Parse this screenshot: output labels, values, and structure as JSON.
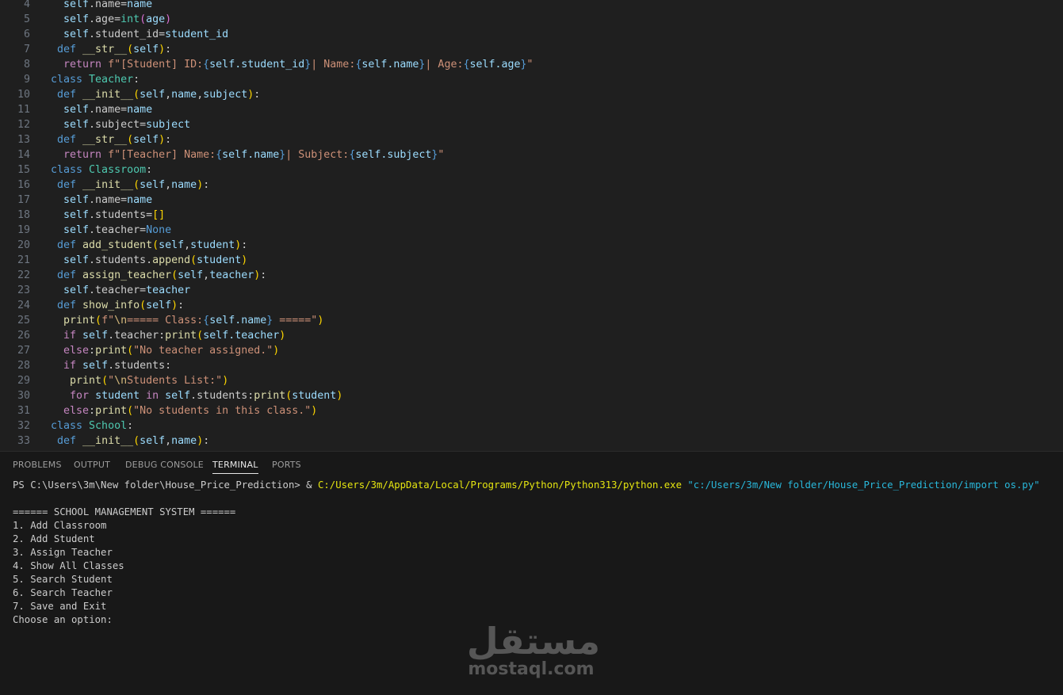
{
  "editor": {
    "lines": [
      {
        "n": "4",
        "code": [
          [
            "  ",
            "p"
          ],
          [
            "self",
            "v"
          ],
          [
            ".name=",
            "p"
          ],
          [
            "name",
            "v"
          ]
        ]
      },
      {
        "n": "5",
        "code": [
          [
            "  ",
            "p"
          ],
          [
            "self",
            "v"
          ],
          [
            ".age=",
            "p"
          ],
          [
            "int",
            "t"
          ],
          [
            "(",
            "b2"
          ],
          [
            "age",
            "v"
          ],
          [
            ")",
            "b2"
          ]
        ]
      },
      {
        "n": "6",
        "code": [
          [
            "  ",
            "p"
          ],
          [
            "self",
            "v"
          ],
          [
            ".student_id=",
            "p"
          ],
          [
            "student_id",
            "v"
          ]
        ]
      },
      {
        "n": "7",
        "code": [
          [
            " ",
            "p"
          ],
          [
            "def ",
            "k"
          ],
          [
            "__str__",
            "f"
          ],
          [
            "(",
            "b"
          ],
          [
            "self",
            "v"
          ],
          [
            ")",
            "b"
          ],
          [
            ":",
            "p"
          ]
        ]
      },
      {
        "n": "8",
        "code": [
          [
            "  ",
            "p"
          ],
          [
            "return ",
            "c"
          ],
          [
            "f\"[Student] ID:",
            "s"
          ],
          [
            "{",
            "k"
          ],
          [
            "self.student_id",
            "v"
          ],
          [
            "}",
            "k"
          ],
          [
            "| Name:",
            "s"
          ],
          [
            "{",
            "k"
          ],
          [
            "self.name",
            "v"
          ],
          [
            "}",
            "k"
          ],
          [
            "| Age:",
            "s"
          ],
          [
            "{",
            "k"
          ],
          [
            "self.age",
            "v"
          ],
          [
            "}",
            "k"
          ],
          [
            "\"",
            "s"
          ]
        ]
      },
      {
        "n": "9",
        "code": [
          [
            "class ",
            "k"
          ],
          [
            "Teacher",
            "t"
          ],
          [
            ":",
            "p"
          ]
        ]
      },
      {
        "n": "10",
        "code": [
          [
            " ",
            "p"
          ],
          [
            "def ",
            "k"
          ],
          [
            "__init__",
            "f"
          ],
          [
            "(",
            "b"
          ],
          [
            "self",
            "v"
          ],
          [
            ",",
            "p"
          ],
          [
            "name",
            "v"
          ],
          [
            ",",
            "p"
          ],
          [
            "subject",
            "v"
          ],
          [
            ")",
            "b"
          ],
          [
            ":",
            "p"
          ]
        ]
      },
      {
        "n": "11",
        "code": [
          [
            "  ",
            "p"
          ],
          [
            "self",
            "v"
          ],
          [
            ".name=",
            "p"
          ],
          [
            "name",
            "v"
          ]
        ]
      },
      {
        "n": "12",
        "code": [
          [
            "  ",
            "p"
          ],
          [
            "self",
            "v"
          ],
          [
            ".subject=",
            "p"
          ],
          [
            "subject",
            "v"
          ]
        ]
      },
      {
        "n": "13",
        "code": [
          [
            " ",
            "p"
          ],
          [
            "def ",
            "k"
          ],
          [
            "__str__",
            "f"
          ],
          [
            "(",
            "b"
          ],
          [
            "self",
            "v"
          ],
          [
            ")",
            "b"
          ],
          [
            ":",
            "p"
          ]
        ]
      },
      {
        "n": "14",
        "code": [
          [
            "  ",
            "p"
          ],
          [
            "return ",
            "c"
          ],
          [
            "f\"[Teacher] Name:",
            "s"
          ],
          [
            "{",
            "k"
          ],
          [
            "self.name",
            "v"
          ],
          [
            "}",
            "k"
          ],
          [
            "| Subject:",
            "s"
          ],
          [
            "{",
            "k"
          ],
          [
            "self.subject",
            "v"
          ],
          [
            "}",
            "k"
          ],
          [
            "\"",
            "s"
          ]
        ]
      },
      {
        "n": "15",
        "code": [
          [
            "class ",
            "k"
          ],
          [
            "Classroom",
            "t"
          ],
          [
            ":",
            "p"
          ]
        ]
      },
      {
        "n": "16",
        "code": [
          [
            " ",
            "p"
          ],
          [
            "def ",
            "k"
          ],
          [
            "__init__",
            "f"
          ],
          [
            "(",
            "b"
          ],
          [
            "self",
            "v"
          ],
          [
            ",",
            "p"
          ],
          [
            "name",
            "v"
          ],
          [
            ")",
            "b"
          ],
          [
            ":",
            "p"
          ]
        ]
      },
      {
        "n": "17",
        "code": [
          [
            "  ",
            "p"
          ],
          [
            "self",
            "v"
          ],
          [
            ".name=",
            "p"
          ],
          [
            "name",
            "v"
          ]
        ]
      },
      {
        "n": "18",
        "code": [
          [
            "  ",
            "p"
          ],
          [
            "self",
            "v"
          ],
          [
            ".students=",
            "p"
          ],
          [
            "[]",
            "b"
          ]
        ]
      },
      {
        "n": "19",
        "code": [
          [
            "  ",
            "p"
          ],
          [
            "self",
            "v"
          ],
          [
            ".teacher=",
            "p"
          ],
          [
            "None",
            "k"
          ]
        ]
      },
      {
        "n": "20",
        "code": [
          [
            " ",
            "p"
          ],
          [
            "def ",
            "k"
          ],
          [
            "add_student",
            "f"
          ],
          [
            "(",
            "b"
          ],
          [
            "self",
            "v"
          ],
          [
            ",",
            "p"
          ],
          [
            "student",
            "v"
          ],
          [
            ")",
            "b"
          ],
          [
            ":",
            "p"
          ]
        ]
      },
      {
        "n": "21",
        "code": [
          [
            "  ",
            "p"
          ],
          [
            "self",
            "v"
          ],
          [
            ".students.",
            "p"
          ],
          [
            "append",
            "f"
          ],
          [
            "(",
            "b"
          ],
          [
            "student",
            "v"
          ],
          [
            ")",
            "b"
          ]
        ]
      },
      {
        "n": "22",
        "code": [
          [
            " ",
            "p"
          ],
          [
            "def ",
            "k"
          ],
          [
            "assign_teacher",
            "f"
          ],
          [
            "(",
            "b"
          ],
          [
            "self",
            "v"
          ],
          [
            ",",
            "p"
          ],
          [
            "teacher",
            "v"
          ],
          [
            ")",
            "b"
          ],
          [
            ":",
            "p"
          ]
        ]
      },
      {
        "n": "23",
        "code": [
          [
            "  ",
            "p"
          ],
          [
            "self",
            "v"
          ],
          [
            ".teacher=",
            "p"
          ],
          [
            "teacher",
            "v"
          ]
        ]
      },
      {
        "n": "24",
        "code": [
          [
            " ",
            "p"
          ],
          [
            "def ",
            "k"
          ],
          [
            "show_info",
            "f"
          ],
          [
            "(",
            "b"
          ],
          [
            "self",
            "v"
          ],
          [
            ")",
            "b"
          ],
          [
            ":",
            "p"
          ]
        ]
      },
      {
        "n": "25",
        "code": [
          [
            "  ",
            "p"
          ],
          [
            "print",
            "f"
          ],
          [
            "(",
            "b"
          ],
          [
            "f\"",
            "s"
          ],
          [
            "\\n",
            "e"
          ],
          [
            "===== Class:",
            "s"
          ],
          [
            "{",
            "k"
          ],
          [
            "self.name",
            "v"
          ],
          [
            "}",
            "k"
          ],
          [
            " =====\"",
            "s"
          ],
          [
            ")",
            "b"
          ]
        ]
      },
      {
        "n": "26",
        "code": [
          [
            "  ",
            "p"
          ],
          [
            "if ",
            "c"
          ],
          [
            "self",
            "v"
          ],
          [
            ".teacher:",
            "p"
          ],
          [
            "print",
            "f"
          ],
          [
            "(",
            "b"
          ],
          [
            "self",
            "v"
          ],
          [
            ".teacher",
            "v"
          ],
          [
            ")",
            "b"
          ]
        ]
      },
      {
        "n": "27",
        "code": [
          [
            "  ",
            "p"
          ],
          [
            "else",
            "c"
          ],
          [
            ":",
            "p"
          ],
          [
            "print",
            "f"
          ],
          [
            "(",
            "b"
          ],
          [
            "\"No teacher assigned.\"",
            "s"
          ],
          [
            ")",
            "b"
          ]
        ]
      },
      {
        "n": "28",
        "code": [
          [
            "  ",
            "p"
          ],
          [
            "if ",
            "c"
          ],
          [
            "self",
            "v"
          ],
          [
            ".students:",
            "p"
          ]
        ]
      },
      {
        "n": "29",
        "code": [
          [
            "   ",
            "p"
          ],
          [
            "print",
            "f"
          ],
          [
            "(",
            "b"
          ],
          [
            "\"",
            "s"
          ],
          [
            "\\n",
            "e"
          ],
          [
            "Students List:\"",
            "s"
          ],
          [
            ")",
            "b"
          ]
        ]
      },
      {
        "n": "30",
        "code": [
          [
            "   ",
            "p"
          ],
          [
            "for ",
            "c"
          ],
          [
            "student ",
            "v"
          ],
          [
            "in ",
            "c"
          ],
          [
            "self",
            "v"
          ],
          [
            ".students:",
            "p"
          ],
          [
            "print",
            "f"
          ],
          [
            "(",
            "b"
          ],
          [
            "student",
            "v"
          ],
          [
            ")",
            "b"
          ]
        ]
      },
      {
        "n": "31",
        "code": [
          [
            "  ",
            "p"
          ],
          [
            "else",
            "c"
          ],
          [
            ":",
            "p"
          ],
          [
            "print",
            "f"
          ],
          [
            "(",
            "b"
          ],
          [
            "\"No students in this class.\"",
            "s"
          ],
          [
            ")",
            "b"
          ]
        ]
      },
      {
        "n": "32",
        "code": [
          [
            "class ",
            "k"
          ],
          [
            "School",
            "t"
          ],
          [
            ":",
            "p"
          ]
        ]
      },
      {
        "n": "33",
        "code": [
          [
            " ",
            "p"
          ],
          [
            "def ",
            "k"
          ],
          [
            "__init__",
            "f"
          ],
          [
            "(",
            "b"
          ],
          [
            "self",
            "v"
          ],
          [
            ",",
            "p"
          ],
          [
            "name",
            "v"
          ],
          [
            ")",
            "b"
          ],
          [
            ":",
            "p"
          ]
        ]
      }
    ]
  },
  "panel": {
    "tabs": [
      {
        "label": "PROBLEMS",
        "active": false
      },
      {
        "label": "OUTPUT",
        "active": false
      },
      {
        "label": "DEBUG CONSOLE",
        "active": false
      },
      {
        "label": "TERMINAL",
        "active": true
      },
      {
        "label": "PORTS",
        "active": false
      }
    ],
    "terminal": {
      "prompt": "PS C:\\Users\\3m\\New folder\\House_Price_Prediction> & ",
      "exe": "C:/Users/3m/AppData/Local/Programs/Python/Python313/python.exe",
      "arg": " \"c:/Users/3m/New folder/House_Price_Prediction/import os.py\"",
      "output": [
        "",
        "====== SCHOOL MANAGEMENT SYSTEM ======",
        "1. Add Classroom",
        "2. Add Student",
        "3. Assign Teacher",
        "4. Show All Classes",
        "5. Search Student",
        "6. Search Teacher",
        "7. Save and Exit",
        "Choose an option:"
      ]
    }
  },
  "watermark": {
    "arabic": "مستقل",
    "latin": "mostaql.com"
  }
}
